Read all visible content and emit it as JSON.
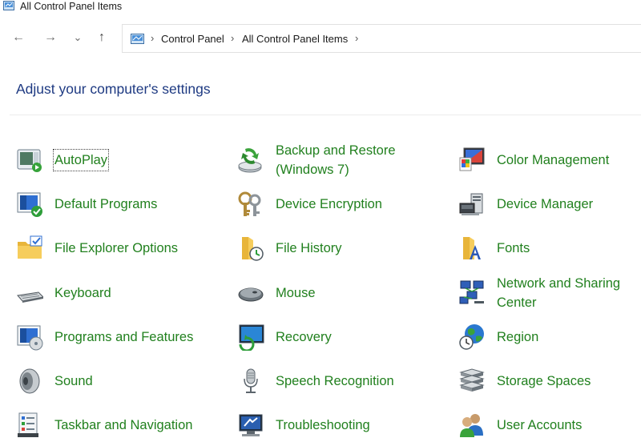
{
  "window": {
    "title": "All Control Panel Items"
  },
  "nav": {
    "back": "←",
    "forward": "→",
    "recent": "⌄",
    "up": "↑"
  },
  "address": {
    "crumbs": [
      "Control Panel",
      "All Control Panel Items"
    ],
    "separator": "›"
  },
  "heading": "Adjust your computer's settings",
  "colors": {
    "link": "#21801e",
    "heading": "#1e3a82"
  },
  "items": [
    {
      "label": "AutoPlay",
      "icon": "autoplay-icon"
    },
    {
      "label": "Backup and Restore",
      "label2": "(Windows 7)",
      "icon": "backup-restore-icon"
    },
    {
      "label": "Color Management",
      "icon": "color-management-icon"
    },
    {
      "label": "Default Programs",
      "icon": "default-programs-icon"
    },
    {
      "label": "Device Encryption",
      "icon": "device-encryption-icon"
    },
    {
      "label": "Device Manager",
      "icon": "device-manager-icon"
    },
    {
      "label": "File Explorer Options",
      "icon": "file-explorer-options-icon"
    },
    {
      "label": "File History",
      "icon": "file-history-icon"
    },
    {
      "label": "Fonts",
      "icon": "fonts-icon"
    },
    {
      "label": "Keyboard",
      "icon": "keyboard-icon"
    },
    {
      "label": "Mouse",
      "icon": "mouse-icon"
    },
    {
      "label": "Network and Sharing",
      "label2": "Center",
      "icon": "network-sharing-icon"
    },
    {
      "label": "Programs and Features",
      "icon": "programs-features-icon"
    },
    {
      "label": "Recovery",
      "icon": "recovery-icon"
    },
    {
      "label": "Region",
      "icon": "region-icon"
    },
    {
      "label": "Sound",
      "icon": "sound-icon"
    },
    {
      "label": "Speech Recognition",
      "icon": "speech-recognition-icon"
    },
    {
      "label": "Storage Spaces",
      "icon": "storage-spaces-icon"
    },
    {
      "label": "Taskbar and Navigation",
      "icon": "taskbar-navigation-icon"
    },
    {
      "label": "Troubleshooting",
      "icon": "troubleshooting-icon"
    },
    {
      "label": "User Accounts",
      "icon": "user-accounts-icon"
    }
  ]
}
